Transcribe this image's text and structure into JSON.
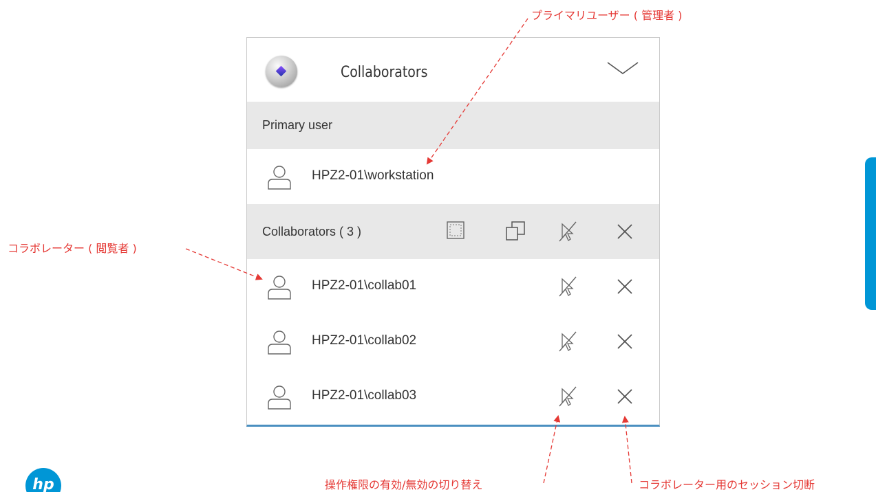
{
  "panel": {
    "title": "Collaborators",
    "primary_section_label": "Primary user",
    "primary_user": "HPZ2-01\\workstation",
    "collaborators_section_label": "Collaborators ( 3 )",
    "collaborators": [
      {
        "name": "HPZ2-01\\collab01"
      },
      {
        "name": "HPZ2-01\\collab02"
      },
      {
        "name": "HPZ2-01\\collab03"
      }
    ]
  },
  "annotations": {
    "primary_user": "プライマリユーザー ( 管理者 )",
    "collaborator": "コラボレーター ( 閲覧者 )",
    "toggle_control": "操作権限の有効/無効の切り替え",
    "disconnect": "コラボレーター用のセッション切断"
  },
  "icons": {
    "app": "app-logo-icon",
    "collapse": "chevron-down-icon",
    "user": "user-icon",
    "select_region": "select-region-icon",
    "copy": "copy-icon",
    "pointer_disabled": "pointer-disabled-icon",
    "close": "close-icon",
    "brand": "hp-logo-icon"
  },
  "colors": {
    "annotation": "#e53935",
    "section_background": "#e8e8e8",
    "panel_bottom_border": "#4a8fc0",
    "side_accent": "#0096d6",
    "brand": "#0096d6"
  }
}
